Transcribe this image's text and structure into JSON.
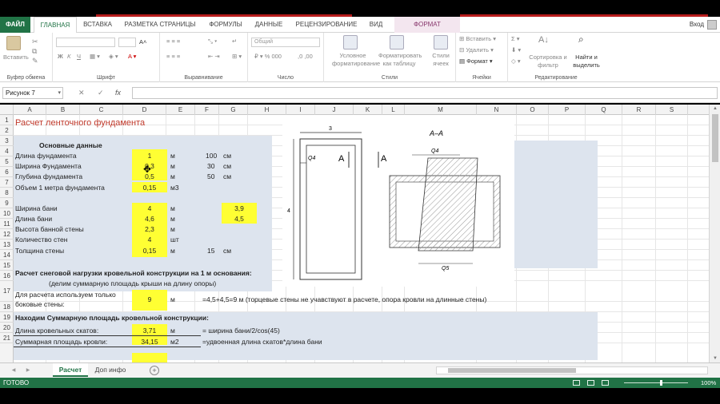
{
  "ribbon_tabs": {
    "file": "ФАЙЛ",
    "home": "ГЛАВНАЯ",
    "insert": "ВСТАВКА",
    "page_layout": "РАЗМЕТКА СТРАНИЦЫ",
    "formulas": "ФОРМУЛЫ",
    "data": "ДАННЫЕ",
    "review": "РЕЦЕНЗИРОВАНИЕ",
    "view": "ВИД",
    "format": "ФОРМАТ"
  },
  "user": {
    "sign_in": "Вход"
  },
  "ribbon": {
    "clipboard": {
      "paste": "Вставить",
      "label": "Буфер обмена"
    },
    "font": {
      "label": "Шрифт",
      "bold": "Ж",
      "italic": "К",
      "underline": "Ч"
    },
    "alignment": {
      "label": "Выравнивание"
    },
    "number": {
      "format": "Общий",
      "label": "Число"
    },
    "styles": {
      "conditional": "Условное форматирование",
      "as_table": "Форматировать как таблицу",
      "cell_styles": "Стили ячеек",
      "label": "Стили"
    },
    "cells": {
      "insert": "Вставить",
      "delete": "Удалить",
      "format": "Формат",
      "label": "Ячейки"
    },
    "editing": {
      "sort": "Сортировка и фильтр",
      "find": "Найти и выделить",
      "label": "Редактирование"
    }
  },
  "formula_bar": {
    "name_box": "Рисунок 7",
    "cancel": "✕",
    "enter": "✓",
    "fx": "fx",
    "formula": ""
  },
  "columns": [
    "A",
    "B",
    "C",
    "D",
    "E",
    "F",
    "G",
    "H",
    "I",
    "J",
    "K",
    "L",
    "M",
    "N",
    "O",
    "P",
    "Q",
    "R",
    "S"
  ],
  "rows": [
    "1",
    "2",
    "3",
    "4",
    "5",
    "6",
    "7",
    "8",
    "9",
    "10",
    "11",
    "12",
    "13",
    "14",
    "15",
    "16",
    "17",
    "18",
    "19",
    "20",
    "21"
  ],
  "cells": {
    "title": "Расчет ленточного фундамента",
    "basic": "Основные данные",
    "len_label": "Длина фундамента",
    "len_val": "1",
    "len_unit": "м",
    "len_cm": "100",
    "len_cm_unit": "см",
    "wid_label": "Ширина Фундамента",
    "wid_val": "0,3",
    "wid_unit": "м",
    "wid_cm": "30",
    "wid_cm_unit": "см",
    "dep_label": "Глубина фундамента",
    "dep_val": "0,5",
    "dep_unit": "м",
    "dep_cm": "50",
    "dep_cm_unit": "см",
    "vol_label": "Объем 1 метра фундамента",
    "vol_val": "0,15",
    "vol_unit": "м3",
    "bw_label": "Ширина бани",
    "bw_val": "4",
    "bw_unit": "м",
    "bw_g": "3,9",
    "bl_label": "Длина бани",
    "bl_val": "4,6",
    "bl_unit": "м",
    "bl_g": "4,5",
    "wh_label": "Высота банной стены",
    "wh_val": "2,3",
    "wh_unit": "м",
    "wc_label": "Количество стен",
    "wc_val": "4",
    "wc_unit": "шт",
    "wt_label": "Толщина стены",
    "wt_val": "0,15",
    "wt_unit": "м",
    "wt_cm": "15",
    "wt_cm_unit": "см",
    "snow": "Расчет снеговой нагрузки кровельной конструкции на 1 м основания:",
    "divide": "(делим суммарную площадь крыши на длину опоры)",
    "use1": "Для расчета используем только",
    "use2": "боковые стены:",
    "use_val": "9",
    "use_unit": "м",
    "use_note": "=4,5+4,5=9 м (торцевые стены не учавствуют в расчете, опора кровли на длинные стены)",
    "find_area": "Находим Суммарную площадь кровельной конструкции:",
    "slope_label": "Длина кровельных скатов:",
    "slope_val": "3,71",
    "slope_unit": "м",
    "slope_note": "= ширина бани/2/cos(45)",
    "area_label": "Суммарная площадь кровли:",
    "area_val": "34,15",
    "area_unit": "м2",
    "area_note": "=удвоенная длина скатов*длина бани"
  },
  "drawing": {
    "section": "А–А",
    "dim3": "3",
    "dim4": "4",
    "q4_left": "Q4",
    "q4_top": "Q4",
    "q5": "Q5",
    "marker": "А"
  },
  "sheets": {
    "active": "Расчет",
    "other": "Доп инфо",
    "add": "+"
  },
  "status": {
    "ready": "ГОТОВО",
    "zoom": "100%"
  },
  "colors": {
    "excel_green": "#217346",
    "yellow": "#ffff33",
    "blue_band": "#dde4ee",
    "title_red": "#c0392b"
  }
}
